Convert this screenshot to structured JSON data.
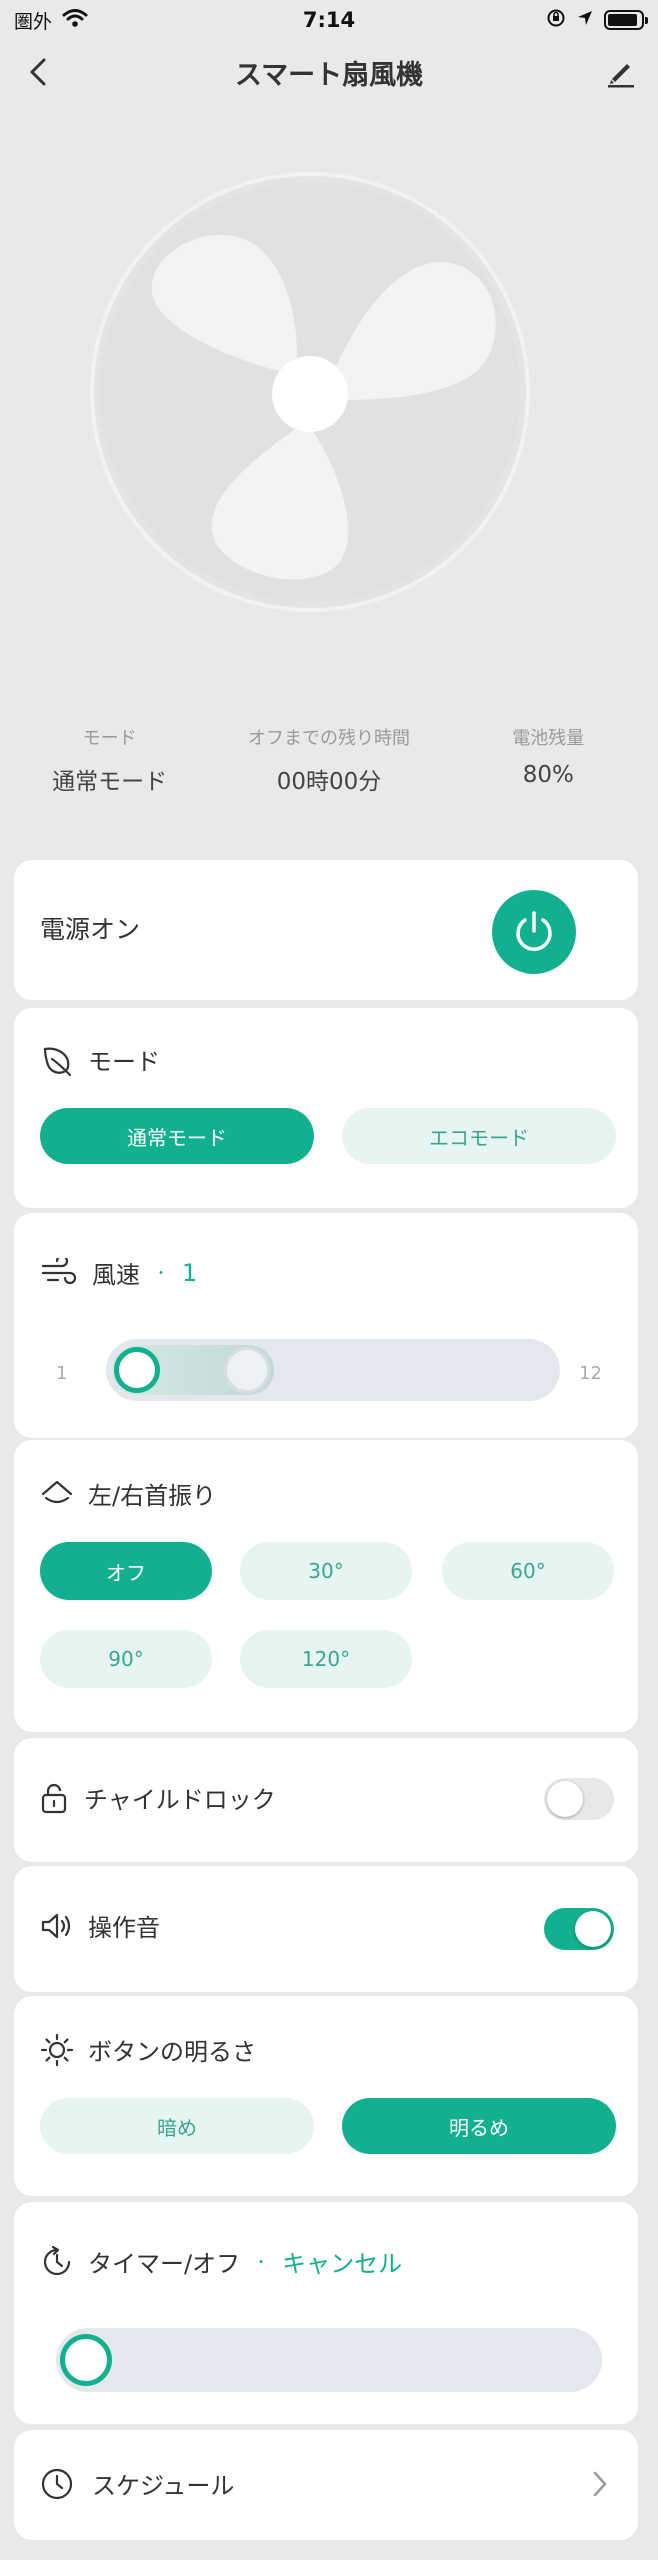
{
  "status_bar": {
    "carrier": "圏外",
    "time": "7:14",
    "battery_level": 0.9
  },
  "header": {
    "title": "スマート扇風機",
    "back_icon": "chevron-left-icon",
    "edit_icon": "pencil-icon"
  },
  "stats": [
    {
      "label": "モード",
      "value": "通常モード"
    },
    {
      "label": "オフまでの残り時間",
      "value": "00時00分"
    },
    {
      "label": "電池残量",
      "value": "80%"
    }
  ],
  "power": {
    "label": "電源オン",
    "icon": "power-icon"
  },
  "mode": {
    "title": "モード",
    "icon": "leaf-icon",
    "options": [
      {
        "label": "通常モード",
        "selected": true
      },
      {
        "label": "エコモード",
        "selected": false
      }
    ]
  },
  "speed": {
    "title": "風速",
    "separator": "・",
    "value": "1",
    "min_label": "1",
    "max_label": "12",
    "icon": "wind-icon",
    "min": 1,
    "max": 12,
    "current": 1
  },
  "swing": {
    "title": "左/右首振り",
    "icon": "house-icon",
    "options": [
      {
        "label": "オフ",
        "selected": true
      },
      {
        "label": "30°",
        "selected": false
      },
      {
        "label": "60°",
        "selected": false
      },
      {
        "label": "90°",
        "selected": false
      },
      {
        "label": "120°",
        "selected": false
      }
    ]
  },
  "child_lock": {
    "title": "チャイルドロック",
    "icon": "lock-icon",
    "enabled": false
  },
  "sound": {
    "title": "操作音",
    "icon": "speaker-icon",
    "enabled": true
  },
  "brightness": {
    "title": "ボタンの明るさ",
    "icon": "sun-icon",
    "options": [
      {
        "label": "暗め",
        "selected": false
      },
      {
        "label": "明るめ",
        "selected": true
      }
    ]
  },
  "timer": {
    "title": "タイマー/オフ",
    "separator": "・",
    "action": "キャンセル",
    "icon": "timer-icon"
  },
  "schedule": {
    "title": "スケジュール",
    "icon": "clock-icon",
    "chevron_icon": "chevron-right-icon"
  },
  "colors": {
    "accent": "#13b08f",
    "accent_light": "#e6f5f2",
    "background": "#e9e9ea"
  }
}
